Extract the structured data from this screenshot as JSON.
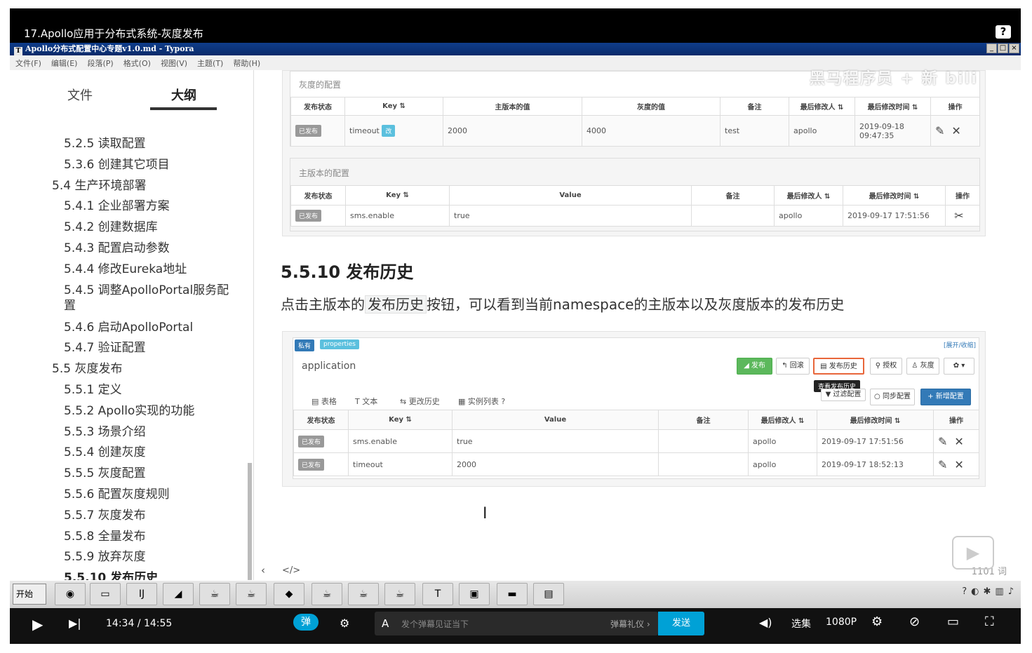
{
  "video": {
    "title": "17.Apollo应用于分布式系统-灰度发布",
    "help": "?"
  },
  "window": {
    "title": "Apollo分布式配置中心专题v1.0.md - Typora",
    "icon": "T",
    "min": "_",
    "max": "□",
    "close": "×"
  },
  "menu": [
    "文件(F)",
    "编辑(E)",
    "段落(P)",
    "格式(O)",
    "视图(V)",
    "主题(T)",
    "帮助(H)"
  ],
  "sidebar": {
    "tabs": {
      "files": "文件",
      "outline": "大纲"
    },
    "items": [
      {
        "label": "5.2.5 读取配置",
        "level": 2
      },
      {
        "label": "5.3.6 创建其它项目",
        "level": 2
      },
      {
        "label": "5.4 生产环境部署",
        "level": 1
      },
      {
        "label": "5.4.1 企业部署方案",
        "level": 2
      },
      {
        "label": "5.4.2 创建数据库",
        "level": 2
      },
      {
        "label": "5.4.3 配置启动参数",
        "level": 2
      },
      {
        "label": "5.4.4 修改Eureka地址",
        "level": 2
      },
      {
        "label": "5.4.5 调整ApolloPortal服务配",
        "level": 2
      },
      {
        "label": "置",
        "level": 2
      },
      {
        "label": "5.4.6 启动ApolloPortal",
        "level": 2
      },
      {
        "label": "5.4.7 验证配置",
        "level": 2
      },
      {
        "label": "5.5 灰度发布",
        "level": 1
      },
      {
        "label": "5.5.1 定义",
        "level": 2
      },
      {
        "label": "5.5.2 Apollo实现的功能",
        "level": 2
      },
      {
        "label": "5.5.3 场景介绍",
        "level": 2
      },
      {
        "label": "5.5.4 创建灰度",
        "level": 2
      },
      {
        "label": "5.5.5 灰度配置",
        "level": 2
      },
      {
        "label": "5.5.6 配置灰度规则",
        "level": 2
      },
      {
        "label": "5.5.7 灰度发布",
        "level": 2
      },
      {
        "label": "5.5.8 全量发布",
        "level": 2
      },
      {
        "label": "5.5.9 放弃灰度",
        "level": 2
      },
      {
        "label": "5.5.10 发布历史",
        "level": 2,
        "active": true
      }
    ]
  },
  "shot1": {
    "gray_title": "灰度的配置",
    "gray_headers": [
      "发布状态",
      "Key ⇅",
      "主版本的值",
      "灰度的值",
      "备注",
      "最后修改人 ⇅",
      "最后修改时间 ⇅",
      "操作"
    ],
    "gray_row": {
      "status": "已发布",
      "key": "timeout",
      "tag": "改",
      "main": "2000",
      "gray": "4000",
      "note": "test",
      "user": "apollo",
      "time": "2019-09-18 09:47:35"
    },
    "main_title": "主版本的配置",
    "main_headers": [
      "发布状态",
      "Key ⇅",
      "Value",
      "备注",
      "最后修改人 ⇅",
      "最后修改时间 ⇅",
      "操作"
    ],
    "main_row": {
      "status": "已发布",
      "key": "sms.enable",
      "value": "true",
      "note": "",
      "user": "apollo",
      "time": "2019-09-17 17:51:56"
    }
  },
  "heading": "5.5.10 发布历史",
  "para": {
    "before": "点击主版本的",
    "code": "发布历史",
    "after": "按钮，可以看到当前namespace的主版本以及灰度版本的发布历史"
  },
  "shot2": {
    "tag_private": "私有",
    "tag_props": "properties",
    "toggle": "[展开/收缩]",
    "app": "application",
    "buttons": [
      "◢ 发布",
      "↰ 回滚",
      "▤ 发布历史",
      "⚲ 授权",
      "♙ 灰度",
      "✿ ▾"
    ],
    "tooltip": "查看发布历史",
    "buttons2": [
      "▼ 过滤配置",
      "○ 同步配置",
      "+ 新增配置"
    ],
    "tabs": [
      "▤ 表格",
      "T 文本",
      "⇆ 更改历史",
      "▦ 实例列表 ?"
    ],
    "headers": [
      "发布状态",
      "Key ⇅",
      "Value",
      "备注",
      "最后修改人 ⇅",
      "最后修改时间 ⇅",
      "操作"
    ],
    "rows": [
      {
        "status": "已发布",
        "key": "sms.enable",
        "value": "true",
        "note": "",
        "user": "apollo",
        "time": "2019-09-17 17:51:56"
      },
      {
        "status": "已发布",
        "key": "timeout",
        "value": "2000",
        "note": "",
        "user": "apollo",
        "time": "2019-09-17 18:52:13"
      }
    ]
  },
  "bottom": {
    "nav": "‹",
    "code": "</>",
    "words": "1101 词"
  },
  "watermark": "黑马程序员 + 新 bili",
  "taskbar": {
    "start": "开始"
  },
  "player": {
    "time": "14:34 / 14:55",
    "danmu_toggle": "弹",
    "danmu_placeholder": "发个弹幕见证当下",
    "etiquette": "弹幕礼仪 ›",
    "send": "发送",
    "select": "选集",
    "quality": "1080P"
  }
}
